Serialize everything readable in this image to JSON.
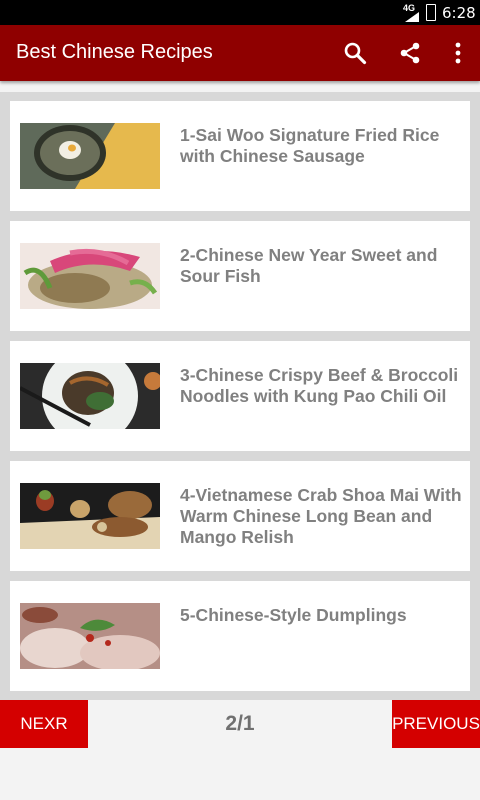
{
  "status_bar": {
    "network": "4G",
    "time": "6:28",
    "icons": [
      "signal-icon",
      "battery-icon"
    ]
  },
  "app_bar": {
    "title": "Best Chinese Recipes",
    "actions": [
      "search-icon",
      "share-icon",
      "more-vert-icon"
    ]
  },
  "recipes": [
    {
      "title": "1-Sai Woo Signature Fried Rice with Chinese Sausage"
    },
    {
      "title": "2-Chinese New Year Sweet and Sour Fish"
    },
    {
      "title": "3-Chinese Crispy Beef & Broccoli Noodles with Kung Pao Chili Oil"
    },
    {
      "title": "4-Vietnamese Crab Shoa Mai With Warm Chinese Long Bean and Mango Relish"
    },
    {
      "title": "5-Chinese-Style Dumplings"
    }
  ],
  "pagination": {
    "next_label": "NEXR",
    "page_indicator": "2/1",
    "previous_label": "PREVIOUS"
  },
  "colors": {
    "app_bar": "#8f0000",
    "button": "#d40000",
    "title_text": "#808080",
    "list_bg": "#d8d8d8"
  }
}
